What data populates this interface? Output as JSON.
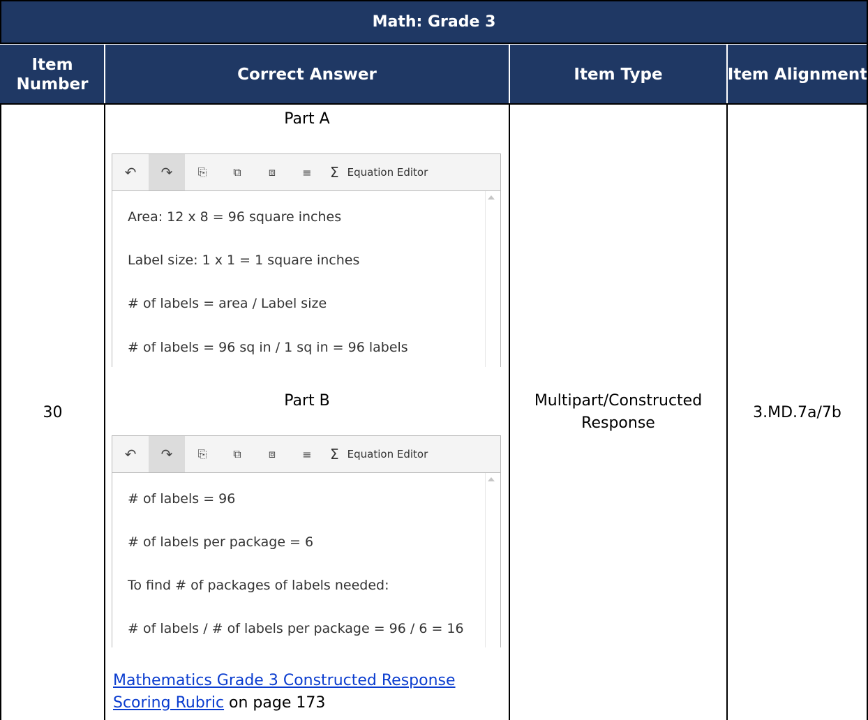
{
  "table_title": "Math: Grade 3",
  "columns": {
    "item_number": "Item\nNumber",
    "correct_answer": "Correct Answer",
    "item_type": "Item Type",
    "item_alignment": "Item Alignment"
  },
  "row": {
    "item_number": "30",
    "item_type": "Multipart/Constructed\nResponse",
    "item_alignment": "3.MD.7a/7b"
  },
  "editor_toolbar": {
    "undo_icon": "undo-icon",
    "redo_icon": "redo-icon",
    "equation_editor_label": "Equation Editor"
  },
  "part_a": {
    "label": "Part A",
    "lines": [
      "Area:  12 x 8 = 96 square inches",
      "Label size:  1 x 1 = 1 square inches",
      "# of labels = area /  Label size",
      "# of labels = 96 sq in / 1 sq in = 96 labels"
    ]
  },
  "part_b": {
    "label": "Part B",
    "lines": [
      "# of labels = 96",
      "# of labels per package = 6",
      "To find # of packages of labels needed:",
      "# of labels / # of labels per package = 96 / 6 = 16"
    ]
  },
  "rubric": {
    "link_text_1": "Mathematics Grade 3 Constructed Response",
    "link_text_2": "Scoring Rubric",
    "suffix": " on page 173"
  },
  "colors": {
    "header_bg": "#1f3864",
    "link": "#0a3ccf"
  }
}
